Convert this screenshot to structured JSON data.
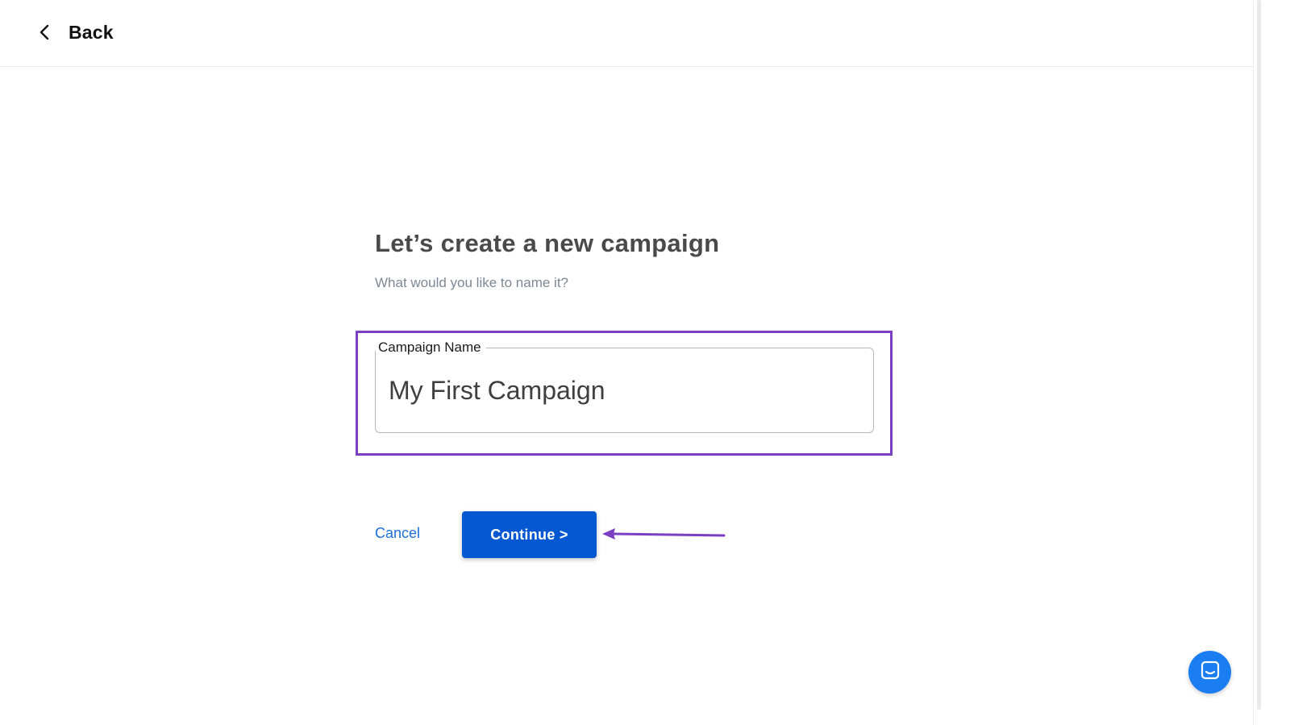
{
  "header": {
    "back_label": "Back"
  },
  "main": {
    "title": "Let’s create a new campaign",
    "subtitle": "What would you like to name it?",
    "field": {
      "label": "Campaign Name",
      "value": "My First Campaign"
    },
    "cancel_label": "Cancel",
    "continue_label": "Continue >"
  },
  "colors": {
    "primary": "#0557d2",
    "link": "#1b6fd8",
    "highlight": "#7b3fc4",
    "chat": "#1a7ef2"
  },
  "icons": {
    "back": "chevron-left-icon",
    "chat": "chat-bubble-icon",
    "annotation": "arrow-left-icon"
  }
}
